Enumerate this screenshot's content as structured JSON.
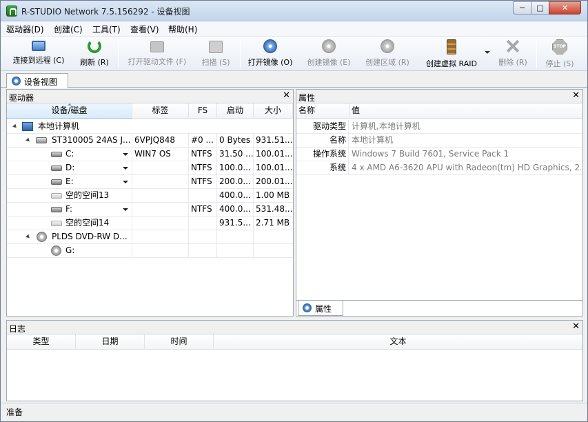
{
  "window": {
    "title": "R-STUDIO Network 7.5.156292 - 设备视图",
    "min_glyph": "─",
    "max_glyph": "□",
    "close_glyph": "✕"
  },
  "menu": [
    "驱动器(D)",
    "创建(C)",
    "工具(T)",
    "查看(V)",
    "帮助(H)"
  ],
  "toolbar": {
    "connect": "连接到远程 (C)",
    "refresh": "刷新 (R)",
    "open_drive_files": "打开驱动文件 (F)",
    "scan": "扫描 (S)",
    "open_image": "打开镜像 (O)",
    "create_image": "创建镜像 (E)",
    "create_region": "创建区域 (R)",
    "create_virtual_raid": "创建虚拟 RAID",
    "delete": "删除 (R)",
    "stop": "停止 (S)",
    "stop_icon_text": "STOP"
  },
  "doc_tab": "设备视图",
  "drives_panel": {
    "title": "驱动器",
    "close": "✕",
    "columns": [
      "设备/磁盘",
      "标签",
      "FS",
      "启动",
      "大小"
    ],
    "rows": [
      {
        "name": "本地计算机",
        "label": "",
        "fs": "",
        "start": "",
        "size": ""
      },
      {
        "name": "ST310005 24AS J...",
        "label": "6VPJQ848",
        "fs": "#0 ...",
        "start": "0 Bytes",
        "size": "931.51..."
      },
      {
        "name": "C:",
        "label": "WIN7 OS",
        "fs": "NTFS",
        "start": "31.50 ...",
        "size": "100.01..."
      },
      {
        "name": "D:",
        "label": "",
        "fs": "NTFS",
        "start": "100.0...",
        "size": "100.01..."
      },
      {
        "name": "E:",
        "label": "",
        "fs": "NTFS",
        "start": "200.0...",
        "size": "200.01..."
      },
      {
        "name": "空的空间13",
        "label": "",
        "fs": "",
        "start": "400.0...",
        "size": "1.00 MB"
      },
      {
        "name": "F:",
        "label": "",
        "fs": "NTFS",
        "start": "400.0...",
        "size": "531.48..."
      },
      {
        "name": "空的空间14",
        "label": "",
        "fs": "",
        "start": "931.5...",
        "size": "2.71 MB"
      },
      {
        "name": "PLDS DVD-RW D...",
        "label": "",
        "fs": "",
        "start": "",
        "size": ""
      },
      {
        "name": "G:",
        "label": "",
        "fs": "",
        "start": "",
        "size": ""
      }
    ]
  },
  "props_panel": {
    "title": "属性",
    "close": "✕",
    "columns": [
      "名称",
      "值"
    ],
    "rows": [
      {
        "name": "驱动类型",
        "value": "计算机,本地计算机"
      },
      {
        "name": "名称",
        "value": "本地计算机"
      },
      {
        "name": "操作系统",
        "value": "Windows 7 Build 7601, Service Pack 1"
      },
      {
        "name": "系统",
        "value": "4 x AMD A6-3620 APU with Radeon(tm) HD Graphics, 2..."
      }
    ],
    "tab": "属性"
  },
  "log_panel": {
    "title": "日志",
    "close": "✕",
    "columns": [
      "类型",
      "日期",
      "时间",
      "文本"
    ]
  },
  "status": "准备"
}
